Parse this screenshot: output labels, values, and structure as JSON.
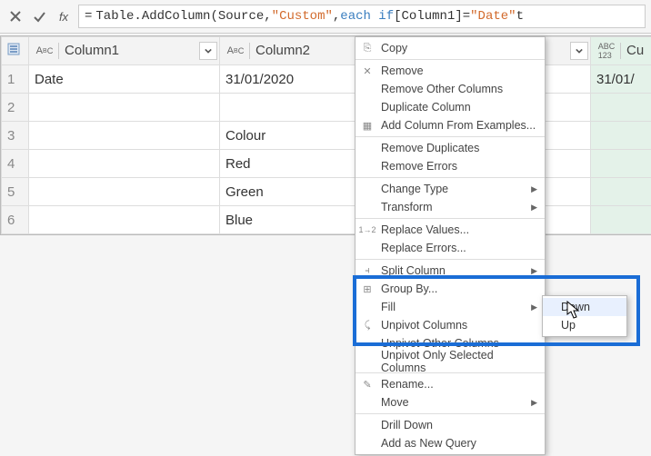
{
  "formula": {
    "eq": "=",
    "fn": "Table.AddColumn",
    "open": "(",
    "arg1": "Source",
    "comma1": ", ",
    "str": "\"Custom\"",
    "comma2": ", ",
    "kw1": "each if ",
    "col": "[Column1]",
    "kw2": " = ",
    "str2": "\"Date\"",
    "tail": " t"
  },
  "columns": {
    "c1": "Column1",
    "c2": "Column2",
    "c3": "Cu"
  },
  "rows": [
    {
      "n": "1",
      "c1": "Date",
      "c2": "31/01/2020",
      "c3": "31/01/"
    },
    {
      "n": "2",
      "c1": "",
      "c2": "",
      "c3": ""
    },
    {
      "n": "3",
      "c1": "",
      "c2": "Colour",
      "c3": ""
    },
    {
      "n": "4",
      "c1": "",
      "c2": "Red",
      "c3": ""
    },
    {
      "n": "5",
      "c1": "",
      "c2": "Green",
      "c3": ""
    },
    {
      "n": "6",
      "c1": "",
      "c2": "Blue",
      "c3": ""
    }
  ],
  "menu": {
    "copy": "Copy",
    "remove": "Remove",
    "removeOther": "Remove Other Columns",
    "duplicate": "Duplicate Column",
    "addFromEx": "Add Column From Examples...",
    "removeDup": "Remove Duplicates",
    "removeErr": "Remove Errors",
    "changeType": "Change Type",
    "transform": "Transform",
    "replaceVals": "Replace Values...",
    "replaceErrs": "Replace Errors...",
    "splitCol": "Split Column",
    "groupBy": "Group By...",
    "fill": "Fill",
    "unpivot": "Unpivot Columns",
    "unpivotOther": "Unpivot Other Columns",
    "unpivotSel": "Unpivot Only Selected Columns",
    "rename": "Rename...",
    "move": "Move",
    "drillDown": "Drill Down",
    "addQuery": "Add as New Query"
  },
  "submenu": {
    "down": "Down",
    "up": "Up"
  }
}
